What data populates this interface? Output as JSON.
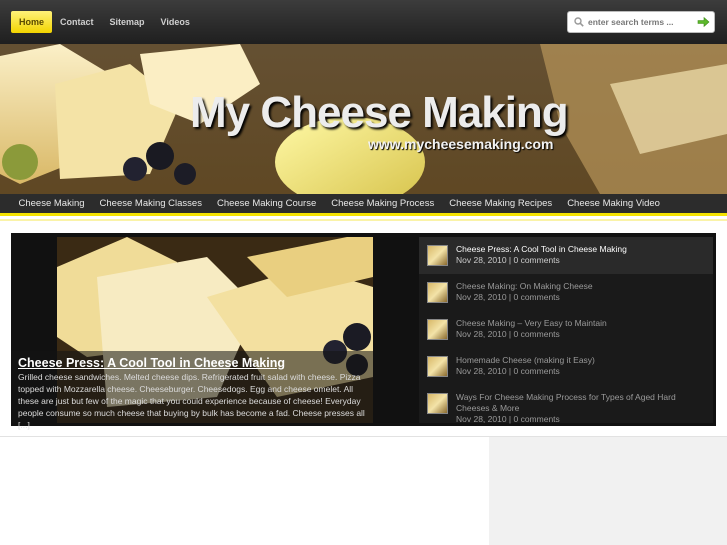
{
  "topnav": {
    "items": [
      {
        "label": "Home",
        "active": true
      },
      {
        "label": "Contact"
      },
      {
        "label": "Sitemap"
      },
      {
        "label": "Videos"
      }
    ]
  },
  "search": {
    "placeholder": "enter search terms ...",
    "icon": "search-icon",
    "submit_icon": "arrow-right-icon"
  },
  "banner": {
    "title": "My Cheese Making",
    "url": "www.mycheesemaking.com"
  },
  "catnav": {
    "items": [
      "Cheese Making",
      "Cheese Making Classes",
      "Cheese Making Course",
      "Cheese Making Process",
      "Cheese Making Recipes",
      "Cheese Making Video"
    ]
  },
  "featured": {
    "title": "Cheese Press: A Cool Tool in Cheese Making",
    "excerpt": "Grilled cheese sandwiches. Melted cheese dips. Refrigerated fruit salad with cheese. Pizza topped with Mozzarella cheese. Cheeseburger. Cheesedogs. Egg and cheese omelet. All these are just but few of the magic that you could experience because of cheese! Everyday people consume so much cheese that buying by bulk has become a fad. Cheese presses all [...]"
  },
  "posts": [
    {
      "title": "Cheese Press: A Cool Tool in Cheese Making",
      "meta": "Nov 28, 2010 | 0 comments"
    },
    {
      "title": "Cheese Making: On Making Cheese",
      "meta": "Nov 28, 2010 | 0 comments"
    },
    {
      "title": "Cheese Making – Very Easy to Maintain",
      "meta": "Nov 28, 2010 | 0 comments"
    },
    {
      "title": "Homemade Cheese (making it Easy)",
      "meta": "Nov 28, 2010 | 0 comments"
    },
    {
      "title": "Ways For Cheese Making Process for Types of Aged Hard Cheeses & More",
      "meta": "Nov 28, 2010 | 0 comments"
    }
  ],
  "colors": {
    "accent": "#f4e200",
    "topbar": "#2a2a2a",
    "featured_bg": "#111111"
  }
}
